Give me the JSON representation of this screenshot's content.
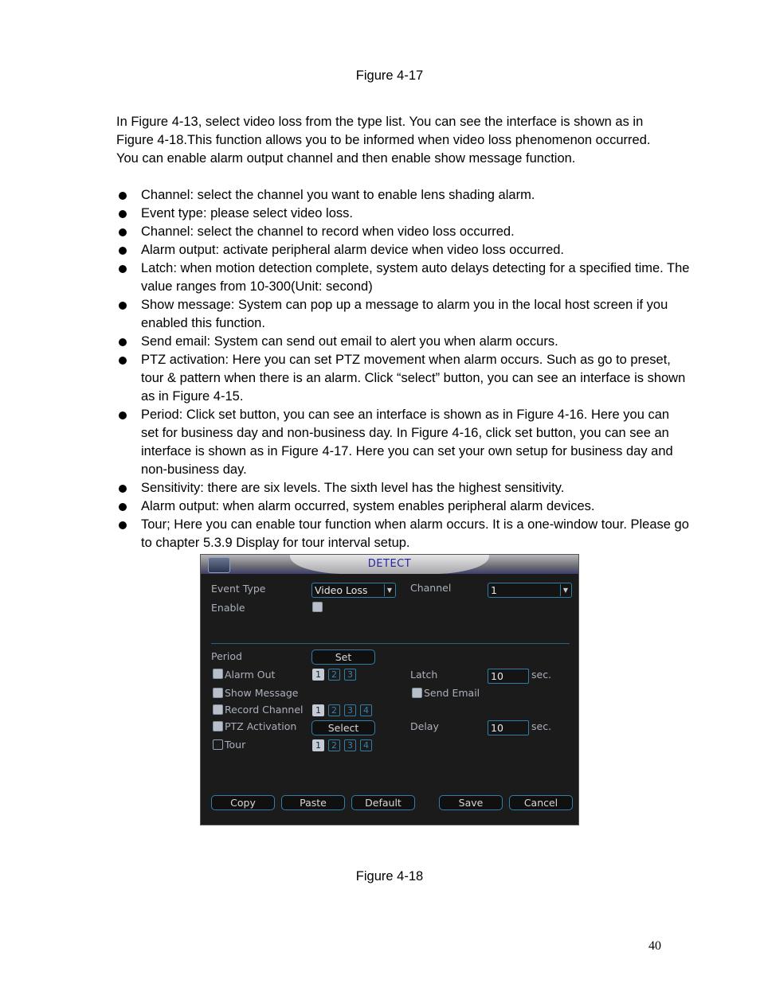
{
  "captions": {
    "top": "Figure 4-17",
    "bottom": "Figure 4-18"
  },
  "paragraph": "In Figure 4-13, select video loss from the type list. You can see the interface is shown as in Figure 4-18.This function allows you to be informed when video loss phenomenon occurred. You can enable alarm output channel and then enable show message function.",
  "bullets": [
    "Channel: select the channel you want to enable lens shading alarm.",
    "Event type: please select video loss.",
    "Channel: select the channel to record when video loss occurred.",
    "Alarm output: activate peripheral alarm device when video loss occurred.",
    "Latch: when motion detection complete, system auto delays detecting for a specified time. The value ranges from 10-300(Unit: second)",
    "Show message: System can pop up a message to alarm you in the local host screen if you enabled this function.",
    "Send email: System can send out email to alert you when alarm occurs.",
    "PTZ activation: Here you can set PTZ movement when alarm occurs. Such as go to preset, tour & pattern when there is an alarm. Click “select” button, you can see an interface is shown as in Figure 4-15.",
    "Period: Click set button, you can see an interface is shown as in Figure 4-16. Here you can set for business day and non-business day. In Figure 4-16, click set button, you can see an interface is shown as in Figure 4-17. Here you can set your own setup for business day and non-business day.",
    "Sensitivity: there are six levels. The sixth level has the highest sensitivity.",
    "Alarm output: when alarm occurred, system enables peripheral alarm devices.",
    "Tour; Here you can enable tour function when alarm occurs.  It is a one-window tour. Please go to chapter 5.3.9 Display for tour interval setup."
  ],
  "dialog": {
    "title": "DETECT",
    "event_type": {
      "label": "Event Type",
      "value": "Video Loss"
    },
    "channel": {
      "label": "Channel",
      "value": "1"
    },
    "enable": {
      "label": "Enable"
    },
    "period": {
      "label": "Period",
      "button": "Set"
    },
    "alarm_out": {
      "label": "Alarm Out",
      "channels": [
        "1",
        "2",
        "3"
      ]
    },
    "latch": {
      "label": "Latch",
      "value": "10",
      "unit": "sec."
    },
    "show_message": {
      "label": "Show Message"
    },
    "send_email": {
      "label": "Send Email"
    },
    "record_channel": {
      "label": "Record Channel",
      "channels": [
        "1",
        "2",
        "3",
        "4"
      ]
    },
    "ptz_activation": {
      "label": "PTZ Activation",
      "button": "Select"
    },
    "delay": {
      "label": "Delay",
      "value": "10",
      "unit": "sec."
    },
    "tour": {
      "label": "Tour",
      "channels": [
        "1",
        "2",
        "3",
        "4"
      ]
    },
    "buttons": {
      "copy": "Copy",
      "paste": "Paste",
      "default": "Default",
      "save": "Save",
      "cancel": "Cancel"
    }
  },
  "page_number": "40"
}
